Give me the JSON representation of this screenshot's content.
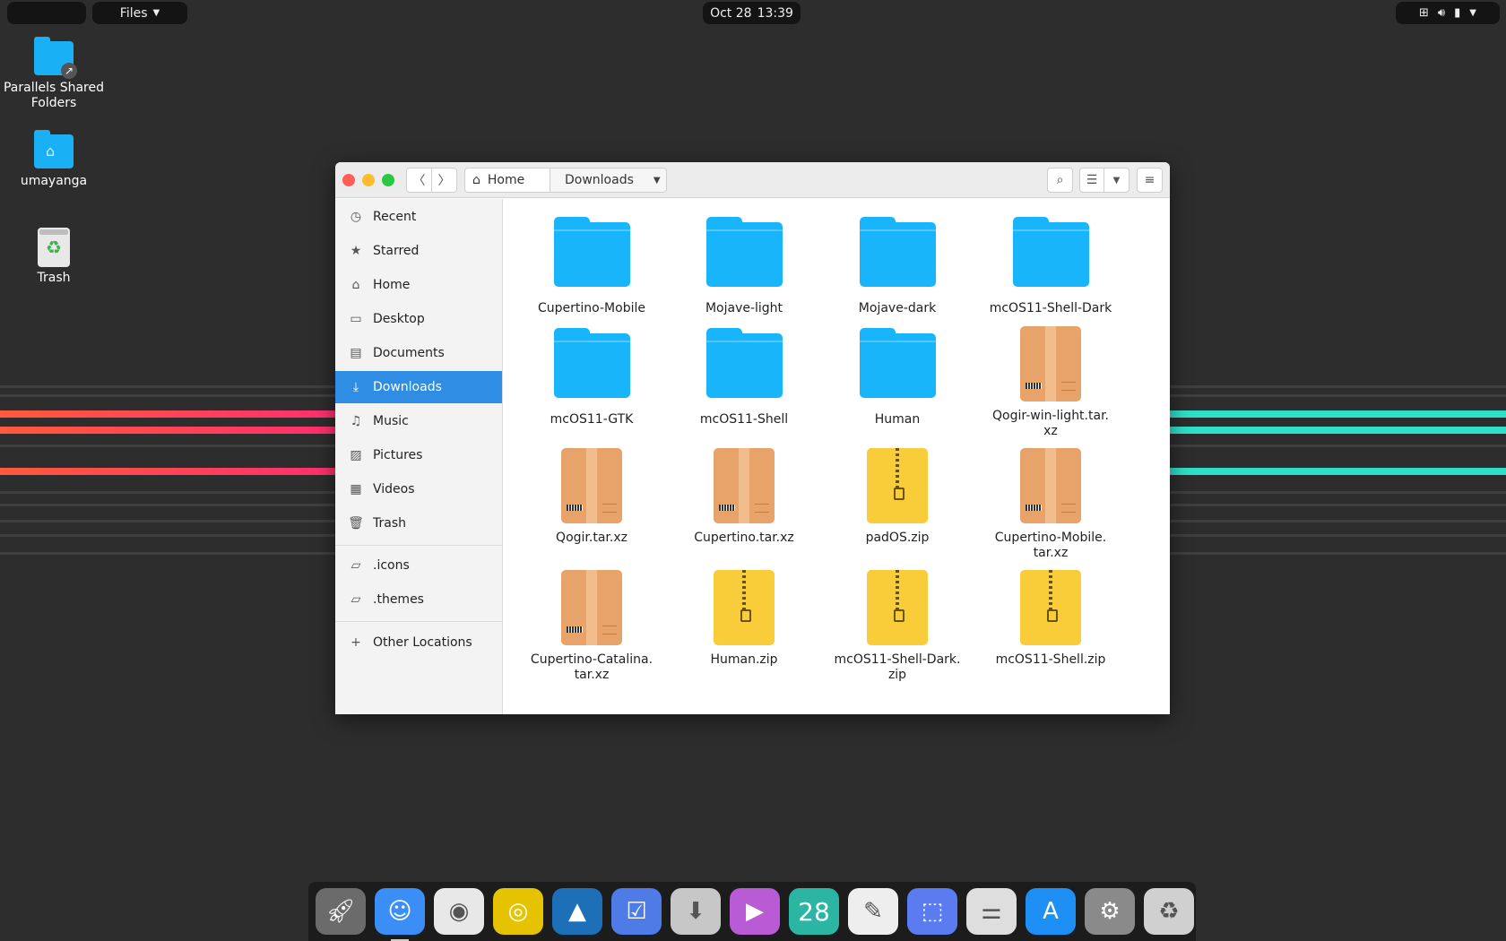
{
  "topbar": {
    "apple_icon": "apple-icon",
    "app_menu_label": "Files",
    "clock_date": "Oct 28",
    "clock_time": "13:39",
    "status_icons": [
      "network-icon",
      "volume-icon",
      "battery-icon"
    ]
  },
  "desktop": {
    "icons": [
      {
        "label": "Parallels Shared Folders",
        "icon": "shared-folder-icon"
      },
      {
        "label": "umayanga",
        "icon": "home-folder-icon"
      },
      {
        "label": "Trash",
        "icon": "trash-icon"
      }
    ]
  },
  "window": {
    "path": {
      "home": "Home",
      "current": "Downloads"
    },
    "sidebar": {
      "items": [
        {
          "label": "Recent",
          "icon": "clock-icon"
        },
        {
          "label": "Starred",
          "icon": "star-icon"
        },
        {
          "label": "Home",
          "icon": "home-icon"
        },
        {
          "label": "Desktop",
          "icon": "desktop-icon"
        },
        {
          "label": "Documents",
          "icon": "document-icon"
        },
        {
          "label": "Downloads",
          "icon": "download-icon",
          "active": true
        },
        {
          "label": "Music",
          "icon": "music-icon"
        },
        {
          "label": "Pictures",
          "icon": "picture-icon"
        },
        {
          "label": "Videos",
          "icon": "video-icon"
        },
        {
          "label": "Trash",
          "icon": "trash-icon"
        }
      ],
      "bookmarks": [
        {
          "label": ".icons",
          "icon": "folder-icon"
        },
        {
          "label": ".themes",
          "icon": "folder-icon"
        }
      ],
      "other_locations": "Other Locations"
    },
    "files": [
      {
        "name": "Cupertino-Mobile",
        "kind": "folder"
      },
      {
        "name": "Mojave-light",
        "kind": "folder"
      },
      {
        "name": "Mojave-dark",
        "kind": "folder"
      },
      {
        "name": "mcOS11-Shell-Dark",
        "kind": "folder"
      },
      {
        "name": "mcOS11-GTK",
        "kind": "folder"
      },
      {
        "name": "mcOS11-Shell",
        "kind": "folder"
      },
      {
        "name": "Human",
        "kind": "folder"
      },
      {
        "name": "Qogir-win-light.tar.\nxz",
        "kind": "tar"
      },
      {
        "name": "Qogir.tar.xz",
        "kind": "tar"
      },
      {
        "name": "Cupertino.tar.xz",
        "kind": "tar"
      },
      {
        "name": "padOS.zip",
        "kind": "zip"
      },
      {
        "name": "Cupertino-Mobile.\ntar.xz",
        "kind": "tar"
      },
      {
        "name": "Cupertino-Catalina.\ntar.xz",
        "kind": "tar"
      },
      {
        "name": "Human.zip",
        "kind": "zip"
      },
      {
        "name": "mcOS11-Shell-Dark.\nzip",
        "kind": "zip"
      },
      {
        "name": "mcOS11-Shell.zip",
        "kind": "zip"
      }
    ]
  },
  "dock": {
    "apps": [
      {
        "name": "launchpad-icon",
        "color": "#6b6b6b"
      },
      {
        "name": "finder-icon",
        "color": "#3a8ef5",
        "running": true
      },
      {
        "name": "photo-booth-icon",
        "color": "#e8e8e8"
      },
      {
        "name": "rhythmbox-icon",
        "color": "#e6c300"
      },
      {
        "name": "image-viewer-icon",
        "color": "#1d6fb8"
      },
      {
        "name": "tasks-icon",
        "color": "#4e7be6"
      },
      {
        "name": "installer-icon",
        "color": "#c7c7c7"
      },
      {
        "name": "video-player-icon",
        "color": "#b85bd4"
      },
      {
        "name": "calendar-icon",
        "color": "#2bb5a3",
        "text": "28"
      },
      {
        "name": "text-editor-icon",
        "color": "#eeeeee"
      },
      {
        "name": "screenshot-icon",
        "color": "#5a7cf0"
      },
      {
        "name": "tweaks-icon",
        "color": "#dedede"
      },
      {
        "name": "app-store-icon",
        "color": "#1e90f5"
      },
      {
        "name": "settings-icon",
        "color": "#8a8a8a"
      },
      {
        "name": "trash-icon",
        "color": "#d0d0d0"
      }
    ]
  }
}
